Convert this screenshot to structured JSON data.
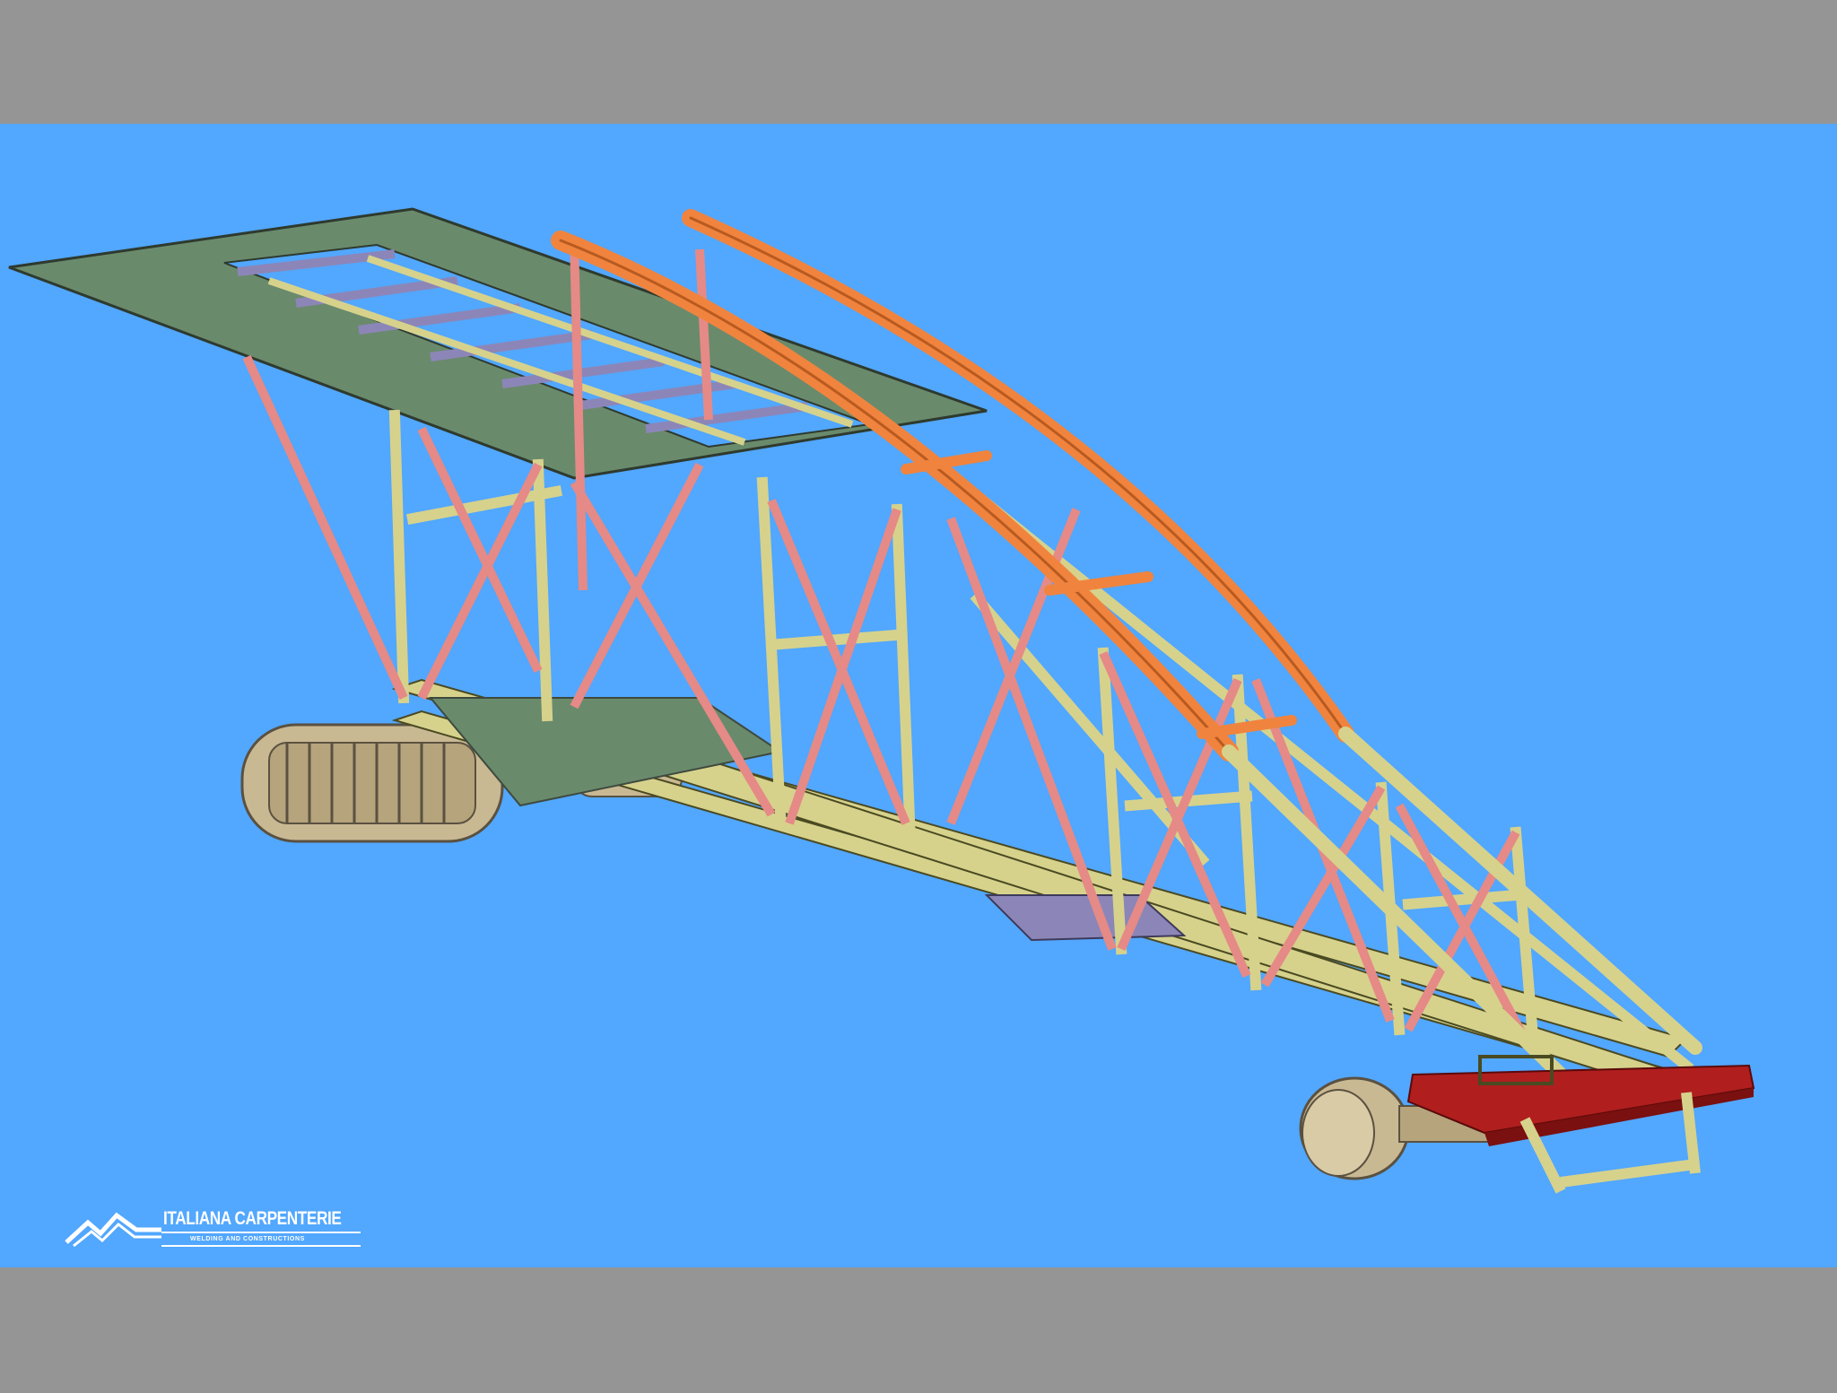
{
  "logo": {
    "title": "ITALIANA CARPENTERIE",
    "subtitle": "WELDING AND CONSTRUCTIONS"
  },
  "colors": {
    "frame_band": "#959595",
    "background": "#52a7fe",
    "deck_plate": "#6a8a6c",
    "yellow_member": "#d6d28c",
    "pink_member": "#e58a86",
    "orange_arch": "#f0843e",
    "red_base": "#b01e1e",
    "track": "#c9b993",
    "grating": "#8c86b8"
  },
  "icons": [
    "logo-mountain-icon"
  ]
}
